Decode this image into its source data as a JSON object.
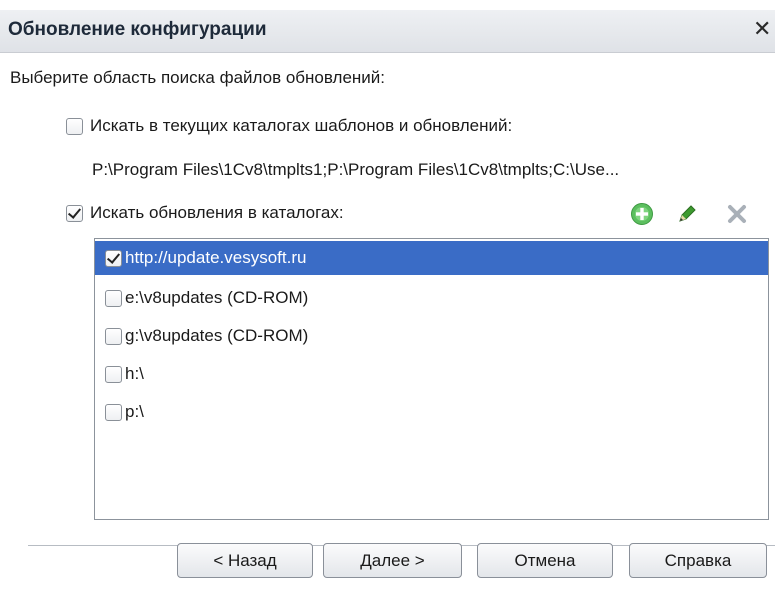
{
  "window": {
    "title": "Обновление конфигурации",
    "close_glyph": "✕"
  },
  "prompt": "Выберите область поиска файлов обновлений:",
  "option_templates": {
    "label": "Искать в текущих каталогах шаблонов и обновлений:",
    "checked": false,
    "paths": "P:\\Program Files\\1Cv8\\tmplts1;P:\\Program Files\\1Cv8\\tmplts;C:\\Use..."
  },
  "option_catalogs": {
    "label": "Искать обновления в каталогах:",
    "checked": true
  },
  "toolbar": {
    "add_icon": "add-icon",
    "edit_icon": "pencil-icon",
    "delete_icon": "delete-icon"
  },
  "catalogs": [
    {
      "label": "http://update.vesysoft.ru",
      "checked": true,
      "selected": true
    },
    {
      "label": "e:\\v8updates (CD-ROM)",
      "checked": false,
      "selected": false
    },
    {
      "label": "g:\\v8updates (CD-ROM)",
      "checked": false,
      "selected": false
    },
    {
      "label": "h:\\",
      "checked": false,
      "selected": false
    },
    {
      "label": "p:\\",
      "checked": false,
      "selected": false
    }
  ],
  "buttons": {
    "back": "< Назад",
    "next": "Далее >",
    "cancel": "Отмена",
    "help": "Справка"
  },
  "colors": {
    "selection": "#3a6cc6",
    "add_icon": "#4caf50",
    "edit_icon": "#3d9a2f",
    "delete_icon": "#b0b6bd"
  }
}
